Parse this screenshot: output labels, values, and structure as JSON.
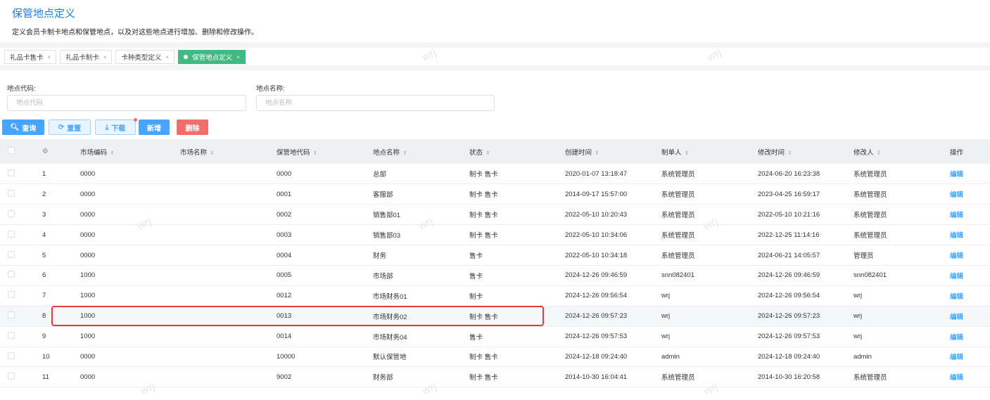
{
  "page": {
    "title": "保管地点定义",
    "description": "定义会员卡制卡地点和保管地点，以及对这些地点进行增加、删除和修改操作。"
  },
  "tabs": [
    {
      "label": "礼品卡售卡"
    },
    {
      "label": "礼品卡制卡"
    },
    {
      "label": "卡种类型定义"
    },
    {
      "label": "保管地点定义",
      "active": true
    }
  ],
  "tab_close": "×",
  "filters": {
    "code_label": "地点代码:",
    "code_placeholder": "地点代码",
    "name_label": "地点名称:",
    "name_placeholder": "地点名称"
  },
  "buttons": {
    "query": "查询",
    "reset": "重置",
    "download": "下载",
    "add": "新增",
    "delete": "删除"
  },
  "watermark": "wrj",
  "table": {
    "headers": [
      "市场编码",
      "市场名称",
      "保管地代码",
      "地点名称",
      "状态",
      "创建时间",
      "制单人",
      "修改时间",
      "修改人",
      "操作"
    ],
    "rows": [
      [
        "1",
        "0000",
        "",
        "0000",
        "总部",
        "制卡 售卡",
        "2020-01-07 13:18:47",
        "系统管理员",
        "2024-06-20 16:23:38",
        "系统管理员",
        "编辑"
      ],
      [
        "2",
        "0000",
        "",
        "0001",
        "客服部",
        "制卡 售卡",
        "2014-09-17 15:57:00",
        "系统管理员",
        "2023-04-25 16:59:17",
        "系统管理员",
        "编辑"
      ],
      [
        "3",
        "0000",
        "",
        "0002",
        "销售部01",
        "制卡 售卡",
        "2022-05-10 10:20:43",
        "系统管理员",
        "2022-05-10 10:21:16",
        "系统管理员",
        "编辑"
      ],
      [
        "4",
        "0000",
        "",
        "0003",
        "销售部03",
        "制卡 售卡",
        "2022-05-10 10:34:06",
        "系统管理员",
        "2022-12-25 11:14:16",
        "系统管理员",
        "编辑"
      ],
      [
        "5",
        "0000",
        "",
        "0004",
        "财务",
        "售卡",
        "2022-05-10 10:34:18",
        "系统管理员",
        "2024-06-21 14:05:57",
        "管理员",
        "编辑"
      ],
      [
        "6",
        "1000",
        "",
        "0005",
        "市场部",
        "售卡",
        "2024-12-26 09:46:59",
        "snn082401",
        "2024-12-26 09:46:59",
        "snn082401",
        "编辑"
      ],
      [
        "7",
        "1000",
        "",
        "0012",
        "市场财务01",
        "制卡",
        "2024-12-26 09:56:54",
        "wrj",
        "2024-12-26 09:56:54",
        "wrj",
        "编辑"
      ],
      [
        "8",
        "1000",
        "",
        "0013",
        "市场财务02",
        "制卡 售卡",
        "2024-12-26 09:57:23",
        "wrj",
        "2024-12-26 09:57:23",
        "wrj",
        "编辑"
      ],
      [
        "9",
        "1000",
        "",
        "0014",
        "市场财务04",
        "售卡",
        "2024-12-26 09:57:53",
        "wrj",
        "2024-12-26 09:57:53",
        "wrj",
        "编辑"
      ],
      [
        "10",
        "0000",
        "",
        "10000",
        "默认保管地",
        "制卡 售卡",
        "2024-12-18 09:24:40",
        "admin",
        "2024-12-18 09:24:40",
        "admin",
        "编辑"
      ],
      [
        "11",
        "0000",
        "",
        "9002",
        "财务部",
        "制卡 售卡",
        "2014-10-30 16:04:41",
        "系统管理员",
        "2014-10-30 16:20:58",
        "系统管理员",
        "编辑"
      ]
    ],
    "highlighted_row": 8
  }
}
